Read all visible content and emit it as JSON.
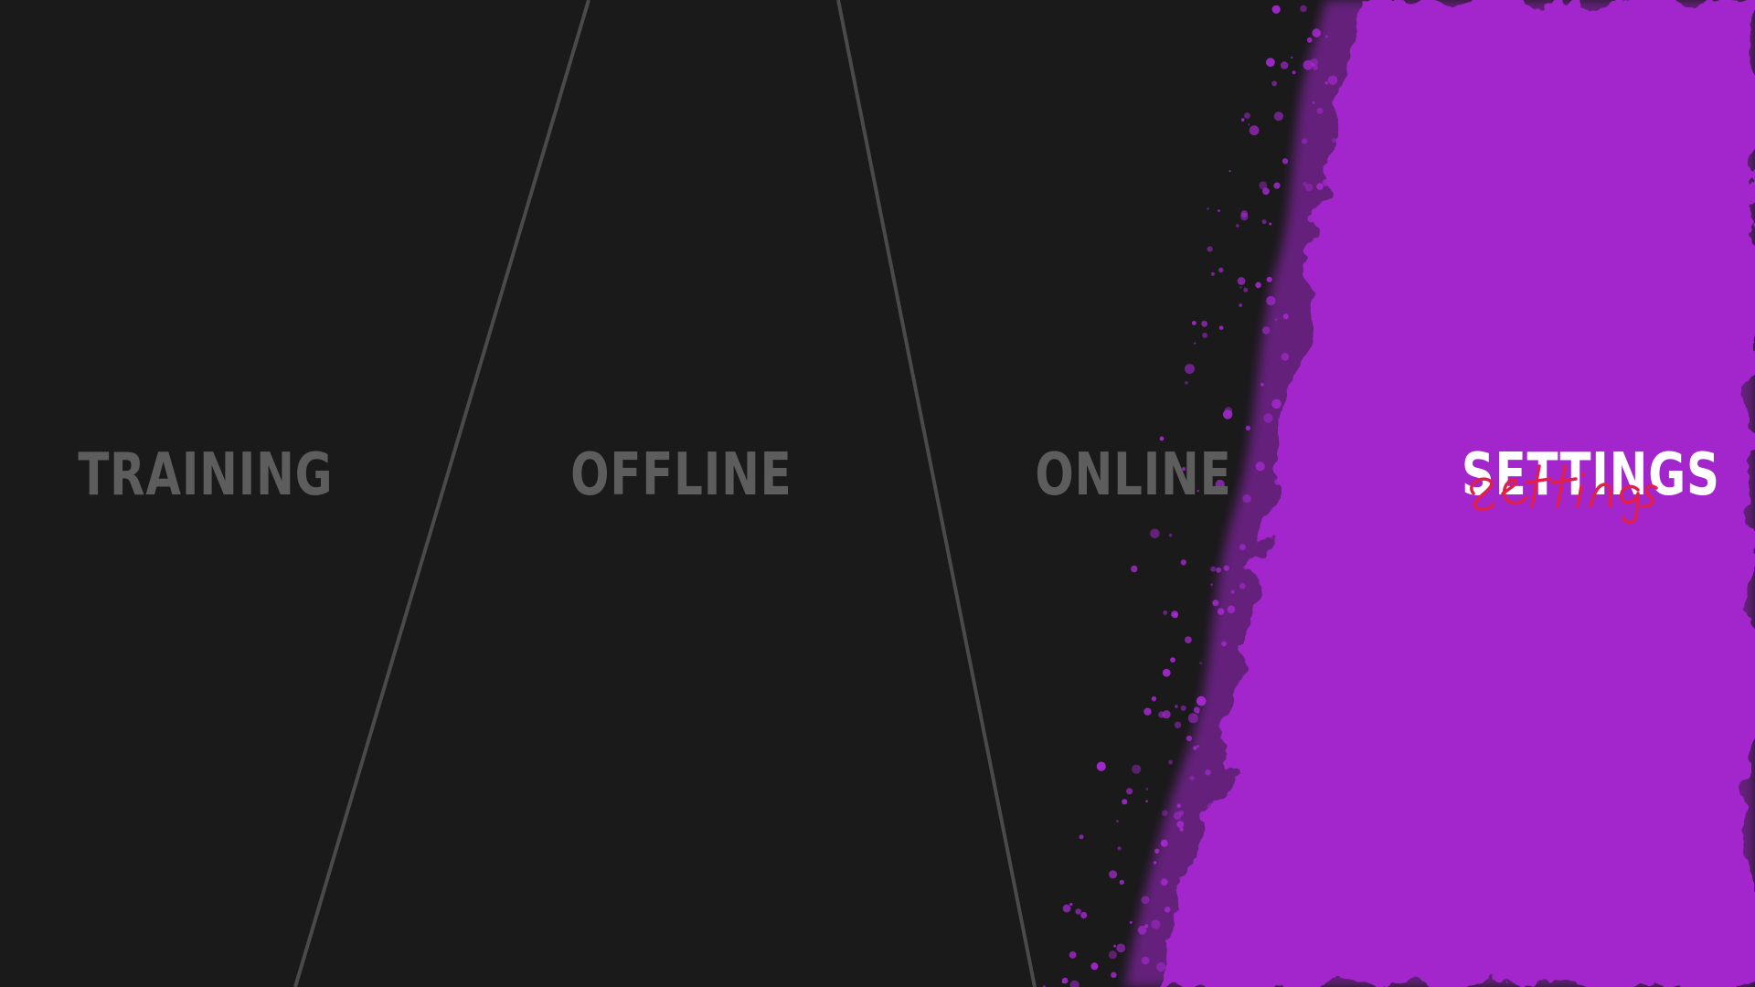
{
  "menu": {
    "items": [
      {
        "id": "training",
        "label": "TRAINING"
      },
      {
        "id": "offline",
        "label": "OFFLINE"
      },
      {
        "id": "online",
        "label": "ONLINE"
      },
      {
        "id": "settings",
        "label": "SETTINGS"
      }
    ],
    "active": "settings"
  },
  "colors": {
    "background": "#1a1a1b",
    "divider": "#4a4a4b",
    "inactive_label": "#5d5d5e",
    "active_label": "#ffffff",
    "splash": "#a228cb",
    "script_accent": "#e0204a"
  }
}
